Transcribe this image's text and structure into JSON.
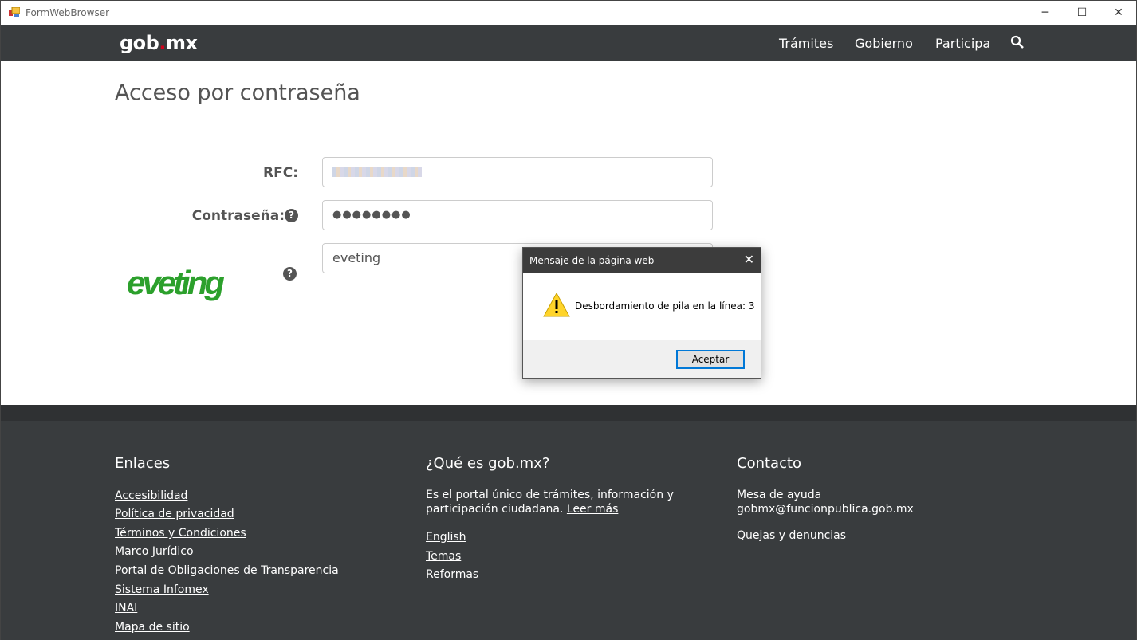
{
  "window": {
    "title": "FormWebBrowser",
    "minimize": "─",
    "maximize": "☐",
    "close": "✕"
  },
  "nav": {
    "logo_left": "gob",
    "logo_dot": ".",
    "logo_right": "mx",
    "links": [
      "Trámites",
      "Gobierno",
      "Participa"
    ],
    "search_icon": "search-icon"
  },
  "form": {
    "title": "Acceso por contraseña",
    "rfc_label": "RFC:",
    "rfc_value": "",
    "password_label": "Contraseña:",
    "password_value": "●●●●●●●●",
    "captcha_value": "eveting",
    "captcha_image_text": "eveting",
    "help": "?"
  },
  "dialog": {
    "title": "Mensaje de la página web",
    "message": "Desbordamiento de pila en la línea: 3",
    "ok": "Aceptar",
    "icon": "warning-icon"
  },
  "footer": {
    "links_title": "Enlaces",
    "links": [
      "Accesibilidad",
      "Política de privacidad",
      "Términos y Condiciones",
      "Marco Jurídico",
      "Portal de Obligaciones de Transparencia",
      "Sistema Infomex",
      "INAI",
      "Mapa de sitio"
    ],
    "about_title": "¿Qué es gob.mx?",
    "about_text_1": "Es el portal único de trámites, información y",
    "about_text_2": "participación ciudadana.",
    "about_more": "Leer más",
    "about_links": [
      "English",
      "Temas",
      "Reformas"
    ],
    "contact_title": "Contacto",
    "contact_help": "Mesa de ayuda",
    "contact_email": "gobmx@funcionpublica.gob.mx",
    "contact_link": "Quejas y denuncias"
  }
}
